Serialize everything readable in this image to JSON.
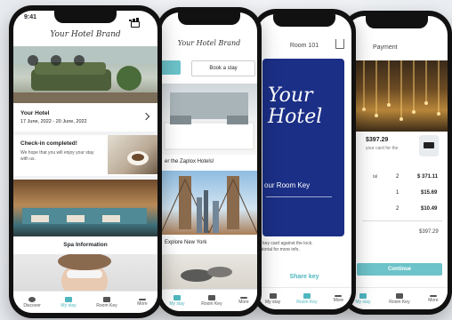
{
  "brand": {
    "logo_text": "Your Hotel Brand"
  },
  "colors": {
    "accent": "#6cc3c9",
    "dark_blue": "#1b2f86",
    "background": "#eef0f3"
  },
  "phone1": {
    "time": "9:41",
    "hotel_name": "Your Hotel",
    "dates": "17 June, 2022 - 20 June, 2022",
    "checkin_title": "Check-in completed!",
    "checkin_text": "We hope that you will enjoy your stay with us.",
    "spa_label": "Spa Information",
    "tabs": [
      {
        "label": "Discover",
        "icon": "discover-icon"
      },
      {
        "label": "My stay",
        "icon": "bed-icon"
      },
      {
        "label": "Room Key",
        "icon": "key-icon"
      },
      {
        "label": "More",
        "icon": "more-icon"
      }
    ]
  },
  "phone2": {
    "book_stay": "Book a stay",
    "zaplox_caption": "er the Zaplox Hotels!",
    "explore_label": "Explore New York",
    "tabs": [
      {
        "label": "My stay",
        "icon": "bed-icon"
      },
      {
        "label": "Room Key",
        "icon": "key-icon"
      },
      {
        "label": "More",
        "icon": "more-icon"
      }
    ]
  },
  "phone3": {
    "title": "Room 101",
    "card_brand": "Your Hotel",
    "card_label": "our Room Key",
    "instruction_line1": "e key card against the lock.",
    "instruction_line2": "tutorial for more info.",
    "share_key": "Share key",
    "tabs": [
      {
        "label": "My stay",
        "icon": "bed-icon"
      },
      {
        "label": "Room Key",
        "icon": "key-icon"
      },
      {
        "label": "More",
        "icon": "more-icon"
      }
    ]
  },
  "phone4": {
    "title": "Payment",
    "amount": "397.29",
    "card_text_line1": "your card for the",
    "row_header": "tal",
    "rows": [
      {
        "qty": "2",
        "price": "$ 371.11"
      },
      {
        "qty": "1",
        "price": "$15.69"
      },
      {
        "qty": "2",
        "price": "$10.49"
      }
    ],
    "total": "$397.29",
    "continue": "Continue",
    "tabs": [
      {
        "label": "My stay",
        "icon": "bed-icon"
      },
      {
        "label": "Room Key",
        "icon": "key-icon"
      },
      {
        "label": "More",
        "icon": "more-icon"
      }
    ]
  }
}
